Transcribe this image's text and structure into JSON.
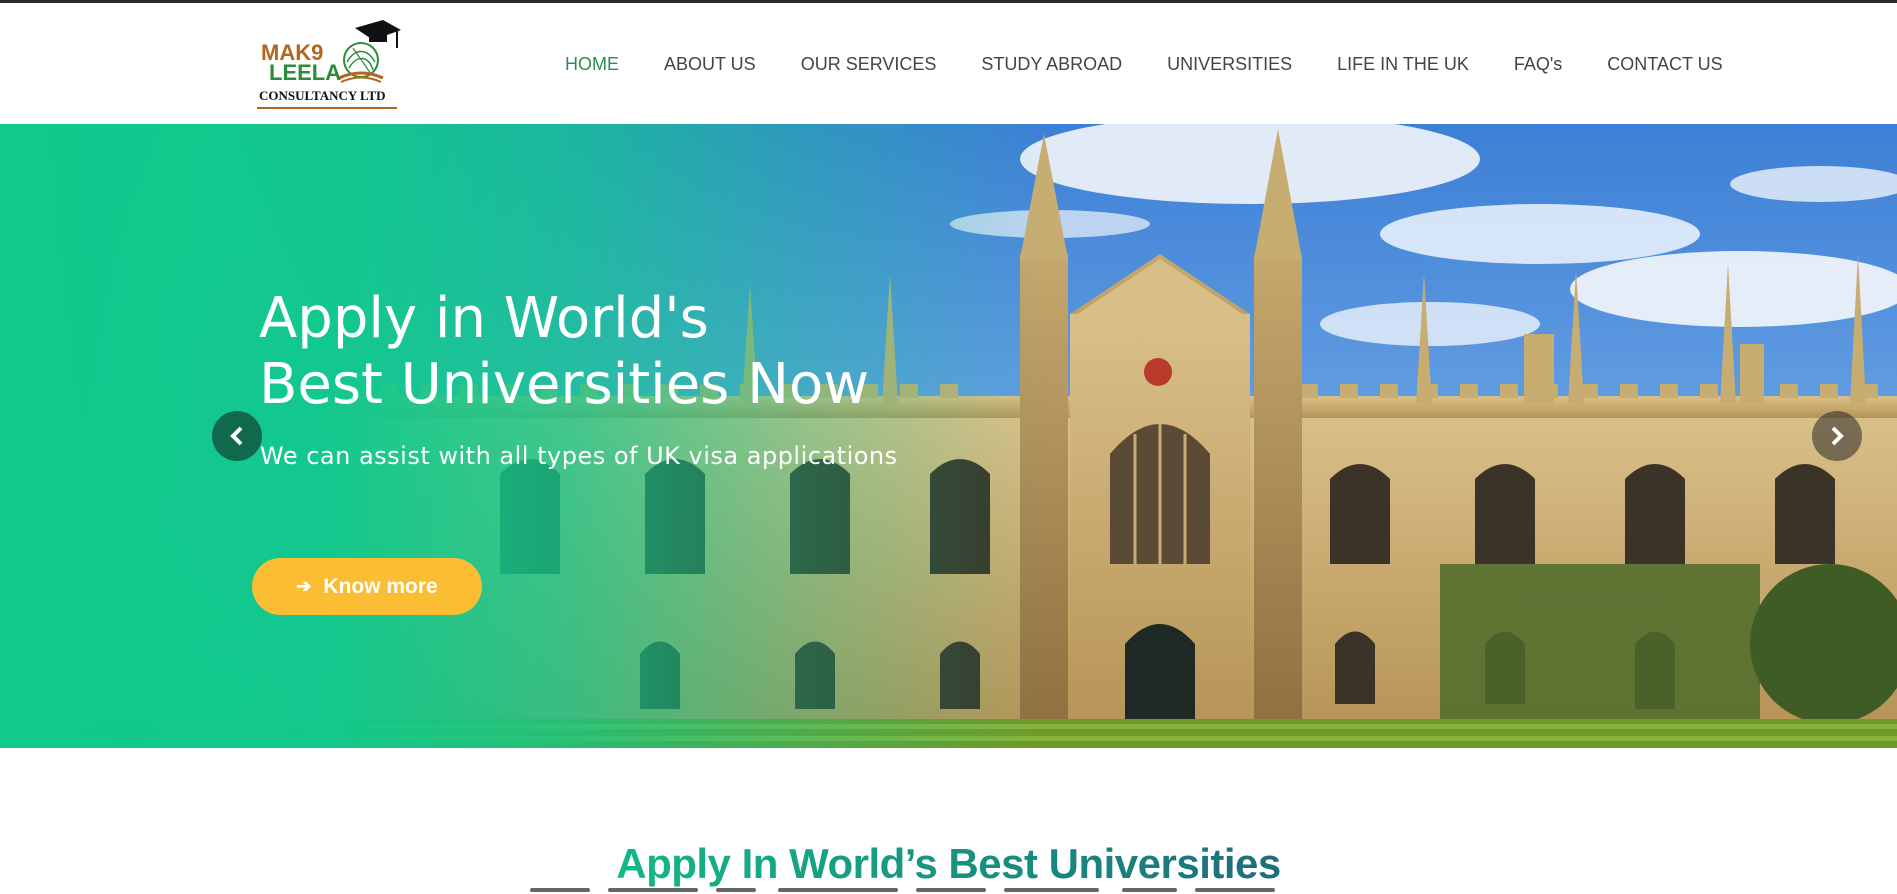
{
  "brand": {
    "logo_line1": "MAK9",
    "logo_line2": "LEELA",
    "logo_line3": "CONSULTANCY LTD"
  },
  "nav": {
    "items": [
      {
        "label": "HOME",
        "active": true
      },
      {
        "label": "ABOUT US",
        "active": false
      },
      {
        "label": "OUR SERVICES",
        "active": false
      },
      {
        "label": "STUDY ABROAD",
        "active": false
      },
      {
        "label": "UNIVERSITIES",
        "active": false
      },
      {
        "label": "LIFE IN THE UK",
        "active": false
      },
      {
        "label": "FAQ's",
        "active": false
      },
      {
        "label": "CONTACT US",
        "active": false
      }
    ]
  },
  "hero": {
    "title_line1": "Apply in World's",
    "title_line2": "Best Universities Now",
    "subtitle": "We can assist with all types of UK visa applications",
    "cta_label": "Know more",
    "cta_icon": "arrow-right-icon",
    "prev_icon": "chevron-left-icon",
    "next_icon": "chevron-right-icon"
  },
  "section": {
    "title": "Apply In World’s Best Universities"
  },
  "colors": {
    "accent_green": "#10c98c",
    "nav_active": "#2e8b57",
    "cta_yellow": "#fbbd34",
    "prev_arrow_bg": "#10694c"
  }
}
